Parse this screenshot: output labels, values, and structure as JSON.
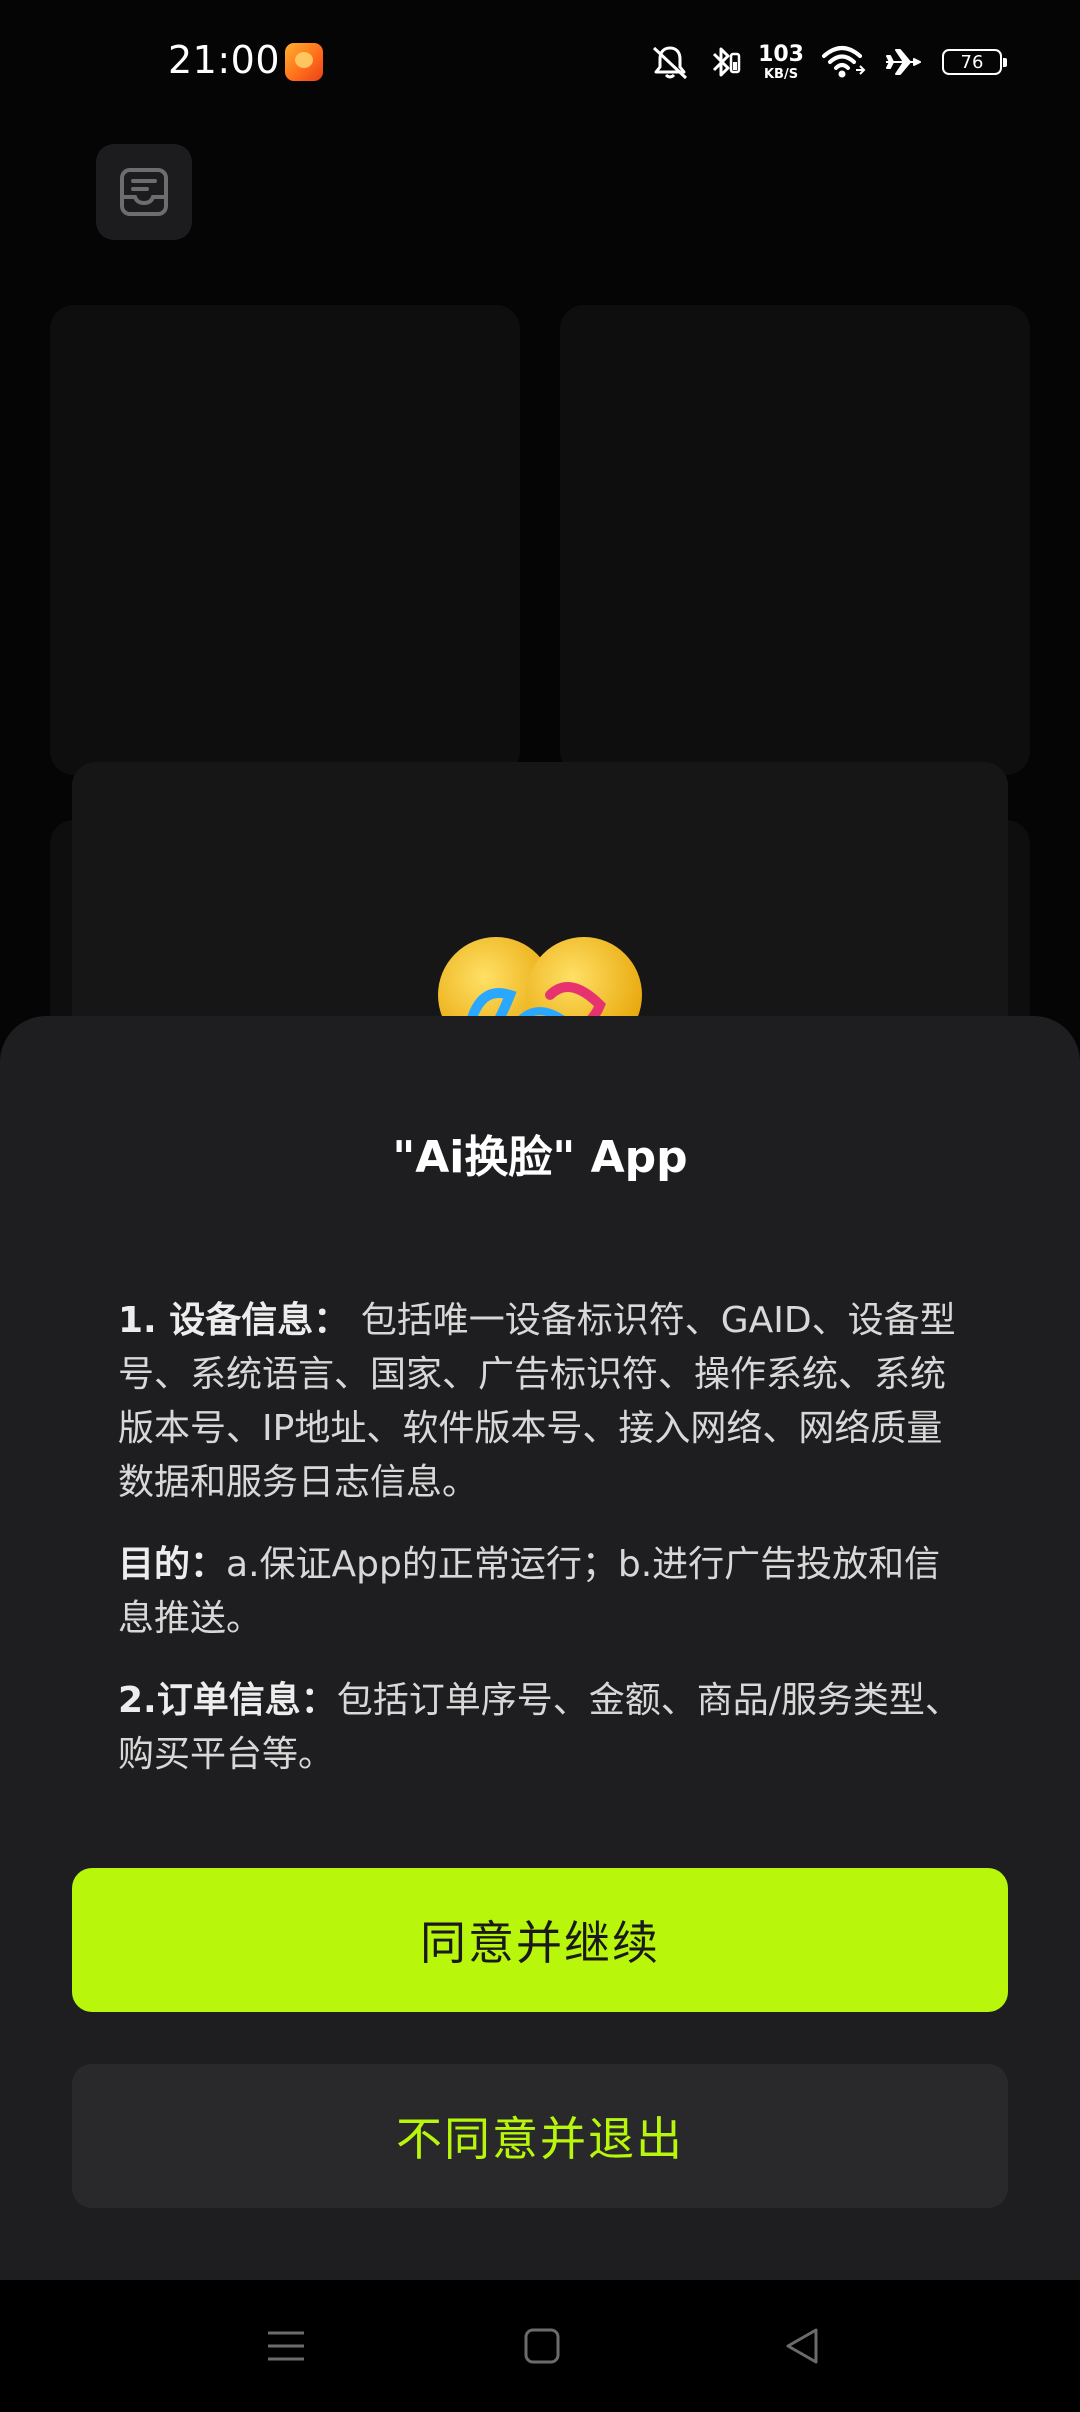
{
  "status_bar": {
    "time": "21:00",
    "net_speed_value": "103",
    "net_speed_unit": "KB/S",
    "battery_level": "76",
    "icons": [
      "notification-app-icon",
      "mute-icon",
      "bluetooth-icon",
      "wifi-icon",
      "airplane-icon",
      "battery-icon"
    ]
  },
  "background_app": {
    "top_button_icon": "inbox-icon"
  },
  "dialog": {
    "title": "\"Ai换脸\" App",
    "paragraphs": [
      {
        "label": "1. 设备信息：",
        "text": " 包括唯一设备标识符、GAID、设备型号、系统语言、国家、广告标识符、操作系统、系统版本号、IP地址、软件版本号、接入网络、网络质量数据和服务日志信息。"
      },
      {
        "label": "目的：",
        "text": "a.保证App的正常运行；b.进行广告投放和信息推送。"
      },
      {
        "label": "2.订单信息：",
        "text": "包括订单序号、金额、商品/服务类型、购买平台等。"
      }
    ],
    "agree_label": "同意并继续",
    "decline_label": "不同意并退出"
  },
  "nav_bar": {
    "icons": [
      "recents-menu-icon",
      "home-square-icon",
      "back-triangle-icon"
    ]
  },
  "colors": {
    "accent": "#B8F70C",
    "sheet_bg": "#1E1E20",
    "decline_bg": "#29292C"
  }
}
